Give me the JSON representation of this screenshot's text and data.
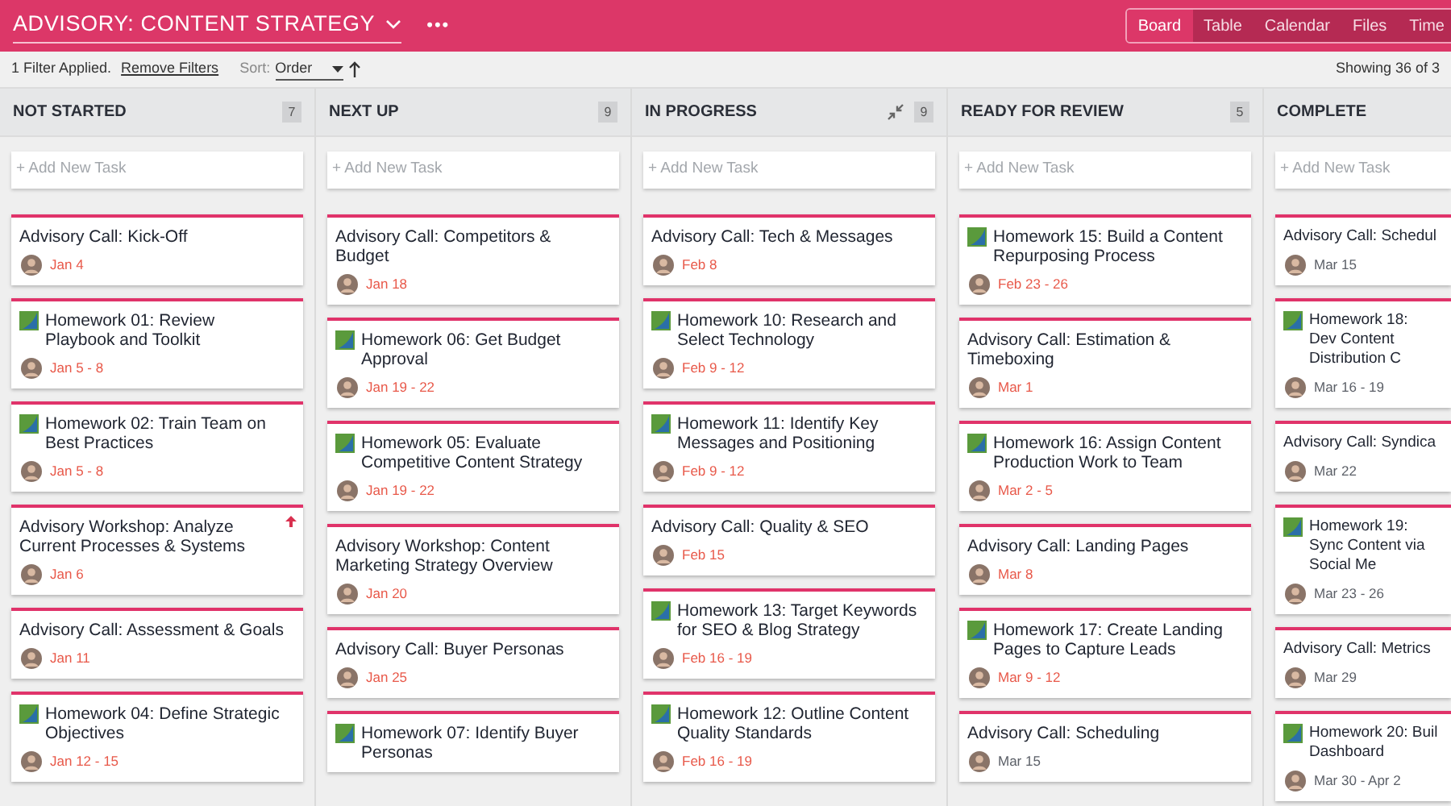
{
  "header": {
    "title": "ADVISORY: CONTENT STRATEGY",
    "more": "•••"
  },
  "view_tabs": [
    {
      "label": "Board",
      "selected": true
    },
    {
      "label": "Table",
      "selected": false
    },
    {
      "label": "Calendar",
      "selected": false
    },
    {
      "label": "Files",
      "selected": false
    },
    {
      "label": "Time",
      "selected": false
    }
  ],
  "toolbar": {
    "filter_text": "1 Filter Applied.",
    "remove_filters": "Remove Filters",
    "sort_label": "Sort:",
    "sort_value": "Order",
    "showing": "Showing 36 of 3"
  },
  "columns": [
    {
      "title": "NOT STARTED",
      "count": "7",
      "collapse_icon": false,
      "add_task": "+ Add New Task",
      "cards": [
        {
          "kind": "call",
          "title": "Advisory Call: Kick-Off",
          "date": "Jan 4",
          "overdue": true,
          "priority": false
        },
        {
          "kind": "homework",
          "title": "Homework 01: Review Playbook and Toolkit",
          "date": "Jan 5 - 8",
          "overdue": true,
          "priority": false
        },
        {
          "kind": "homework",
          "title": "Homework 02: Train Team on Best Practices",
          "date": "Jan 5 - 8",
          "overdue": true,
          "priority": false
        },
        {
          "kind": "call",
          "title": "Advisory Workshop: Analyze Current Processes & Systems",
          "date": "Jan 6",
          "overdue": true,
          "priority": true
        },
        {
          "kind": "call",
          "title": "Advisory Call: Assessment & Goals",
          "date": "Jan 11",
          "overdue": true,
          "priority": false
        },
        {
          "kind": "homework",
          "title": "Homework 04: Define Strategic Objectives",
          "date": "Jan 12 - 15",
          "overdue": true,
          "priority": false
        }
      ]
    },
    {
      "title": "NEXT UP",
      "count": "9",
      "collapse_icon": false,
      "add_task": "+ Add New Task",
      "cards": [
        {
          "kind": "call",
          "title": "Advisory Call: Competitors & Budget",
          "date": "Jan 18",
          "overdue": true,
          "priority": false
        },
        {
          "kind": "homework",
          "title": "Homework 06: Get Budget Approval",
          "date": "Jan 19 - 22",
          "overdue": true,
          "priority": false
        },
        {
          "kind": "homework",
          "title": "Homework 05: Evaluate Competitive Content Strategy",
          "date": "Jan 19 - 22",
          "overdue": true,
          "priority": false
        },
        {
          "kind": "call",
          "title": "Advisory Workshop: Content Marketing Strategy Overview",
          "date": "Jan 20",
          "overdue": true,
          "priority": false
        },
        {
          "kind": "call",
          "title": "Advisory Call: Buyer Personas",
          "date": "Jan 25",
          "overdue": true,
          "priority": false
        },
        {
          "kind": "homework",
          "title": "Homework 07: Identify Buyer Personas",
          "priority": false
        }
      ]
    },
    {
      "title": "IN PROGRESS",
      "count": "9",
      "collapse_icon": true,
      "add_task": "+ Add New Task",
      "cards": [
        {
          "kind": "call",
          "title": "Advisory Call: Tech & Messages",
          "date": "Feb 8",
          "overdue": true,
          "priority": false
        },
        {
          "kind": "homework",
          "title": "Homework 10: Research and Select Technology",
          "date": "Feb 9 - 12",
          "overdue": true,
          "priority": false
        },
        {
          "kind": "homework",
          "title": "Homework 11: Identify Key Messages and Positioning",
          "date": "Feb 9 - 12",
          "overdue": true,
          "priority": false
        },
        {
          "kind": "call",
          "title": "Advisory Call: Quality & SEO",
          "date": "Feb 15",
          "overdue": true,
          "priority": false
        },
        {
          "kind": "homework",
          "title": "Homework 13: Target Keywords for SEO & Blog Strategy",
          "date": "Feb 16 - 19",
          "overdue": true,
          "priority": false
        },
        {
          "kind": "homework",
          "title": "Homework 12: Outline Content Quality Standards",
          "date": "Feb 16 - 19",
          "overdue": true,
          "priority": false
        }
      ]
    },
    {
      "title": "READY FOR REVIEW",
      "count": "5",
      "collapse_icon": false,
      "add_task": "+ Add New Task",
      "cards": [
        {
          "kind": "homework",
          "title": "Homework 15: Build a Content Repurposing Process",
          "date": "Feb 23 - 26",
          "overdue": true,
          "priority": false
        },
        {
          "kind": "call",
          "title": "Advisory Call: Estimation & Timeboxing",
          "date": "Mar 1",
          "overdue": true,
          "priority": false
        },
        {
          "kind": "homework",
          "title": "Homework 16: Assign Content Production Work to Team",
          "date": "Mar 2 - 5",
          "overdue": true,
          "priority": false
        },
        {
          "kind": "call",
          "title": "Advisory Call: Landing Pages",
          "date": "Mar 8",
          "overdue": true,
          "priority": false
        },
        {
          "kind": "homework",
          "title": "Homework 17: Create Landing Pages to Capture Leads",
          "date": "Mar 9 - 12",
          "overdue": true,
          "priority": false
        },
        {
          "kind": "call",
          "title": "Advisory Call: Scheduling",
          "date": "Mar 15",
          "overdue": false,
          "priority": false
        }
      ]
    },
    {
      "title": "COMPLETE",
      "add_task": "+ Add New Task",
      "collapse_icon": false,
      "cards": [
        {
          "kind": "call",
          "title": "Advisory Call: Schedul",
          "date": "Mar 15",
          "overdue": false,
          "priority": false
        },
        {
          "kind": "homework",
          "title": "Homework 18: Dev Content Distribution C",
          "date": "Mar 16 - 19",
          "overdue": false,
          "priority": false
        },
        {
          "kind": "call",
          "title": "Advisory Call: Syndica",
          "date": "Mar 22",
          "overdue": false,
          "priority": false
        },
        {
          "kind": "homework",
          "title": "Homework 19: Sync Content via Social Me",
          "date": "Mar 23 - 26",
          "overdue": false,
          "priority": false
        },
        {
          "kind": "call",
          "title": "Advisory Call: Metrics",
          "date": "Mar 29",
          "overdue": false,
          "priority": false
        },
        {
          "kind": "homework",
          "title": "Homework 20: Buil Dashboard",
          "date": "Mar 30 - Apr 2",
          "overdue": false,
          "priority": false
        }
      ]
    }
  ]
}
